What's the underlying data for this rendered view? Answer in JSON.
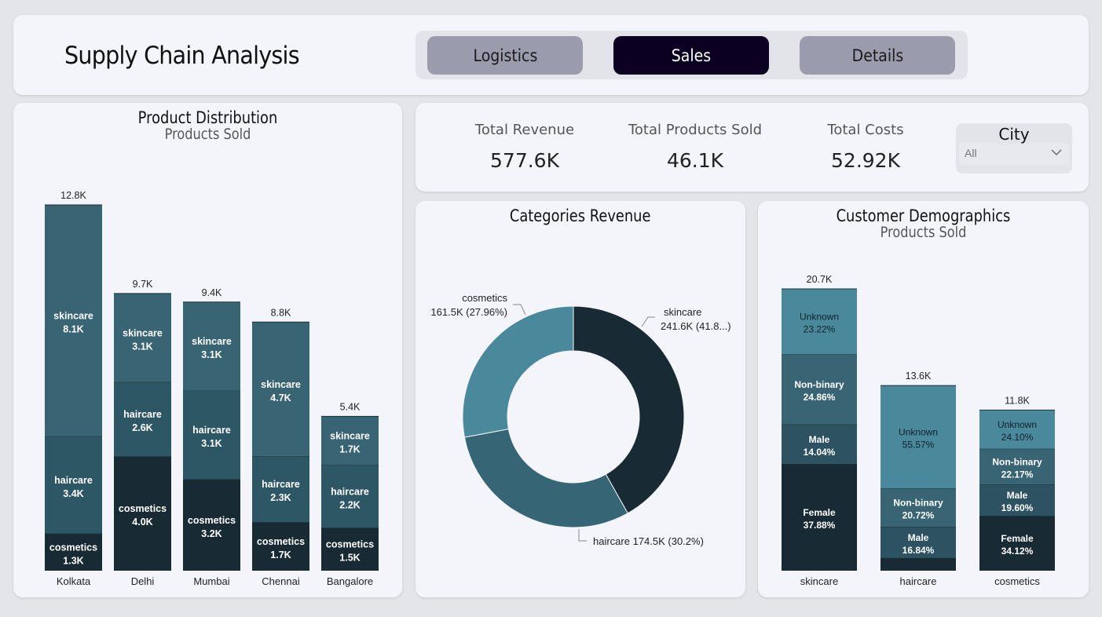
{
  "app": {
    "title": "Supply Chain Analysis"
  },
  "nav": {
    "tabs": [
      {
        "label": "Logistics"
      },
      {
        "label": "Sales"
      },
      {
        "label": "Details"
      }
    ],
    "active": "Sales"
  },
  "kpis": [
    {
      "label": "Total Revenue",
      "value": "577.6K"
    },
    {
      "label": "Total Products Sold",
      "value": "46.1K"
    },
    {
      "label": "Total Costs",
      "value": "52.92K"
    }
  ],
  "filter": {
    "label": "City",
    "value": "All",
    "icon": "chevron-down-icon"
  },
  "colors": {
    "cosmetics": "#182a33",
    "haircare": "#2e5765",
    "skincare": "#386474",
    "donut_skincare": "#182a33",
    "donut_haircare": "#366575",
    "donut_cosmetics": "#4a889c",
    "female": "#182a33",
    "male": "#2d5261",
    "nonbinary": "#386474",
    "unknown": "#4a889c",
    "active_tab": "#0c0022",
    "inactive_tab": "#9a9cae"
  },
  "chart_data": [
    {
      "id": "product_distribution",
      "type": "bar",
      "stacked": true,
      "title": "Product Distribution",
      "subtitle": "Products Sold",
      "categories": [
        "Kolkata",
        "Delhi",
        "Mumbai",
        "Chennai",
        "Bangalore"
      ],
      "totals": [
        12.8,
        9.7,
        9.4,
        8.8,
        5.4
      ],
      "total_labels": [
        "12.8K",
        "9.7K",
        "9.4K",
        "8.8K",
        "5.4K"
      ],
      "series": [
        {
          "name": "cosmetics",
          "values": [
            1.3,
            4.0,
            3.2,
            1.7,
            1.5
          ],
          "labels": [
            "1.3K",
            "4.0K",
            "3.2K",
            "1.7K",
            "1.5K"
          ]
        },
        {
          "name": "haircare",
          "values": [
            3.4,
            2.6,
            3.1,
            2.3,
            2.2
          ],
          "labels": [
            "3.4K",
            "2.6K",
            "3.1K",
            "2.3K",
            "2.2K"
          ]
        },
        {
          "name": "skincare",
          "values": [
            8.1,
            3.1,
            3.1,
            4.7,
            1.7
          ],
          "labels": [
            "8.1K",
            "3.1K",
            "3.1K",
            "4.7K",
            "1.7K"
          ]
        }
      ],
      "ylim": [
        0,
        12.8
      ]
    },
    {
      "id": "categories_revenue",
      "type": "pie",
      "donut": true,
      "title": "Categories Revenue",
      "slices": [
        {
          "name": "skincare",
          "value": 241.6,
          "percent": 41.84,
          "label_line1": "skincare",
          "label_line2": "241.6K (41.8...)"
        },
        {
          "name": "haircare",
          "value": 174.5,
          "percent": 30.2,
          "label_line1": "haircare 174.5K (30.2%)",
          "label_line2": ""
        },
        {
          "name": "cosmetics",
          "value": 161.5,
          "percent": 27.96,
          "label_line1": "cosmetics",
          "label_line2": "161.5K (27.96%)"
        }
      ]
    },
    {
      "id": "customer_demographics",
      "type": "bar",
      "stacked": true,
      "percent_stacked_labels": true,
      "title": "Customer Demographics",
      "subtitle": "Products Sold",
      "categories": [
        "skincare",
        "haircare",
        "cosmetics"
      ],
      "totals": [
        20.7,
        13.6,
        11.8
      ],
      "total_labels": [
        "20.7K",
        "13.6K",
        "11.8K"
      ],
      "series": [
        {
          "name": "Female",
          "percents": [
            37.88,
            6.87,
            34.12
          ],
          "labels": [
            "37.88%",
            "",
            "34.12%"
          ]
        },
        {
          "name": "Male",
          "percents": [
            14.04,
            16.84,
            19.6
          ],
          "labels": [
            "14.04%",
            "16.84%",
            "19.60%"
          ]
        },
        {
          "name": "Non-binary",
          "percents": [
            24.86,
            20.72,
            22.17
          ],
          "labels": [
            "24.86%",
            "20.72%",
            "22.17%"
          ]
        },
        {
          "name": "Unknown",
          "percents": [
            23.22,
            55.57,
            24.1
          ],
          "labels": [
            "23.22%",
            "55.57%",
            "24.10%"
          ]
        }
      ],
      "ylim": [
        0,
        20.7
      ]
    }
  ]
}
